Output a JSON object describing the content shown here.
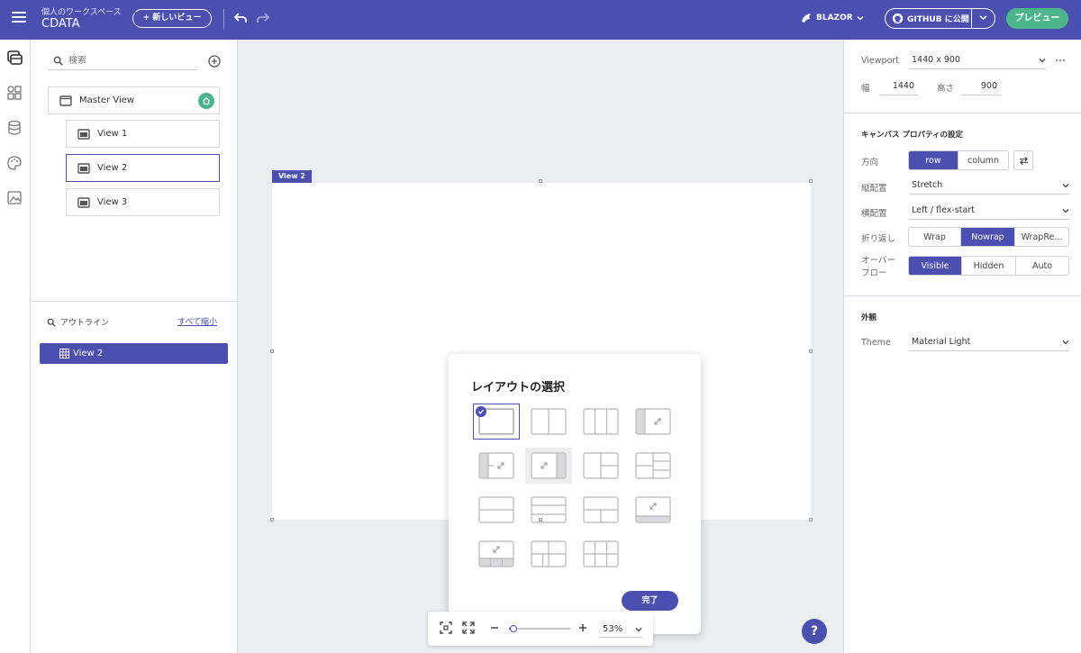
{
  "header": {
    "workspace_label": "個人のワークスペース",
    "project_name": "CDATA",
    "new_view_label": "+ 新しいビュー",
    "platform_label": "BLAZOR",
    "github_label": "GITHUB に公開",
    "preview_label": "プレビュー"
  },
  "left_panel": {
    "search_placeholder": "検索",
    "views": [
      {
        "label": "Master View",
        "home": true
      },
      {
        "label": "View 1"
      },
      {
        "label": "View 2",
        "selected": true
      },
      {
        "label": "View 3"
      }
    ],
    "outline_label": "アウトライン",
    "collapse_all_label": "すべて縮小",
    "outline_items": [
      {
        "label": "View 2"
      }
    ]
  },
  "canvas": {
    "view_tag": "View 2",
    "dialog": {
      "title": "レイアウトの選択",
      "done_label": "完了",
      "selected_index": 0,
      "hover_index": 5
    },
    "zoom": {
      "value": "53%",
      "fraction": 0.08
    }
  },
  "right_panel": {
    "viewport_label": "Viewport",
    "viewport_value": "1440 x 900",
    "width_label": "幅",
    "width_value": "1440",
    "height_label": "高さ",
    "height_value": "900",
    "canvas_section_title": "キャンバス プロパティの設定",
    "direction_label": "方向",
    "direction_options": [
      "row",
      "column"
    ],
    "direction_active": "row",
    "vertical_label": "縦配置",
    "vertical_value": "Stretch",
    "horizontal_label": "横配置",
    "horizontal_value": "Left / flex-start",
    "wrap_label": "折り返し",
    "wrap_options": [
      "Wrap",
      "Nowrap",
      "WrapRe..."
    ],
    "wrap_active": "Nowrap",
    "overflow_label_1": "オーバー",
    "overflow_label_2": "フロー",
    "overflow_options": [
      "Visible",
      "Hidden",
      "Auto"
    ],
    "overflow_active": "Visible",
    "appearance_title": "外観",
    "theme_label": "Theme",
    "theme_value": "Material Light"
  },
  "colors": {
    "accent": "#4a4fb0",
    "success": "#4cb58c",
    "canvas_bg": "#ecedf1"
  }
}
